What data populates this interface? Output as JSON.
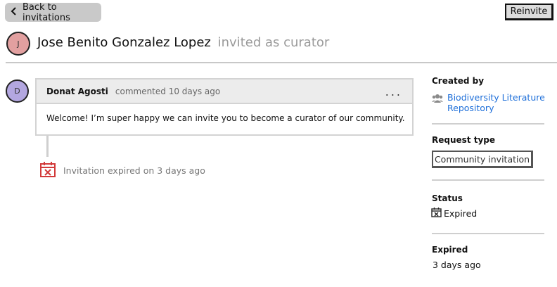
{
  "header": {
    "back_label": "Back to invitations",
    "reinvite_label": "Reinvite"
  },
  "invitation": {
    "avatar_initial": "J",
    "person_name": "Jose Benito Gonzalez Lopez",
    "role_text": "invited as curator"
  },
  "comment": {
    "avatar_initial": "D",
    "author": "Donat Agosti",
    "meta": "commented 10 days ago",
    "menu": "...",
    "body": "Welcome! I’m super happy we can invite you to become a curator of our community."
  },
  "event": {
    "text": "Invitation expired on 3 days ago",
    "icon": "calendar-x-icon",
    "icon_color": "#d23a3a"
  },
  "sidebar": {
    "created_by_label": "Created by",
    "created_by_line1": "Biodiversity Literature",
    "created_by_line2": "Repository",
    "created_by_icon": "users-icon",
    "request_type_label": "Request type",
    "request_type_value": "Community invitation",
    "status_label": "Status",
    "status_value": "Expired",
    "status_icon": "calendar-x-icon",
    "expired_label": "Expired",
    "expired_value": "3 days ago"
  },
  "colors": {
    "link": "#1e6fd9",
    "avatar_j": "#e2a0a0",
    "avatar_d": "#b3a7e0",
    "muted": "#9a9a9a"
  }
}
